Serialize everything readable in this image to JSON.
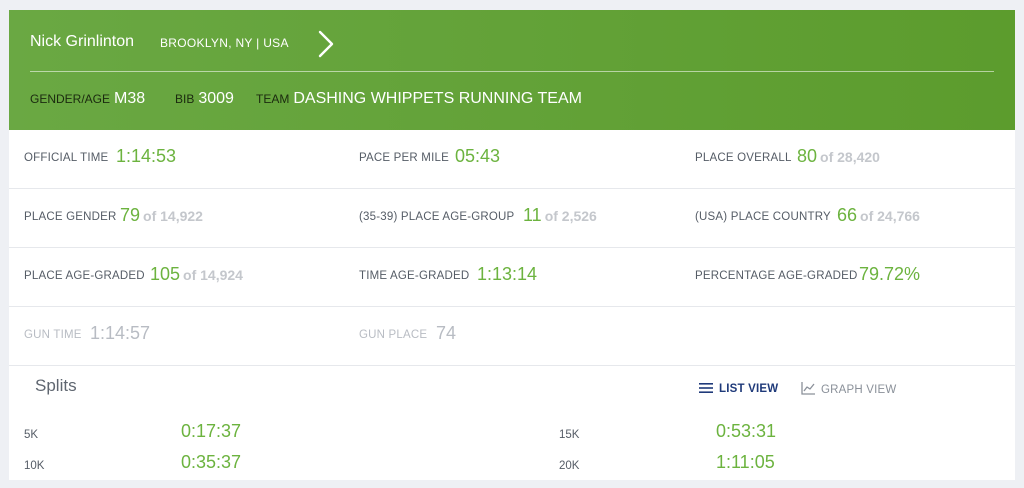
{
  "runner": {
    "name": "Nick Grinlinton",
    "location": "BROOKLYN, NY | USA",
    "gender_age_label": "GENDER/AGE",
    "gender_age": "M38",
    "bib_label": "BIB",
    "bib": "3009",
    "team_label": "TEAM",
    "team": "DASHING WHIPPETS RUNNING TEAM"
  },
  "stats": {
    "official_time": {
      "label": "OFFICIAL TIME",
      "value": "1:14:53"
    },
    "pace_per_mile": {
      "label": "PACE PER MILE",
      "value": "05:43"
    },
    "place_overall": {
      "label": "PLACE OVERALL",
      "value": "80",
      "of": "of 28,420"
    },
    "place_gender": {
      "label": "PLACE GENDER",
      "value": "79",
      "of": "of 14,922"
    },
    "place_age_group": {
      "label": "(35-39) PLACE AGE-GROUP",
      "value": "11",
      "of": "of 2,526"
    },
    "place_country": {
      "label": "(USA) PLACE COUNTRY",
      "value": "66",
      "of": "of 24,766"
    },
    "place_age_graded": {
      "label": "PLACE AGE-GRADED",
      "value": "105",
      "of": "of 14,924"
    },
    "time_age_graded": {
      "label": "TIME AGE-GRADED",
      "value": "1:13:14"
    },
    "percentage_age_graded": {
      "label": "PERCENTAGE AGE-GRADED",
      "value": "79.72%"
    },
    "gun_time": {
      "label": "GUN TIME",
      "value": "1:14:57"
    },
    "gun_place": {
      "label": "GUN PLACE",
      "value": "74"
    }
  },
  "splits": {
    "title": "Splits",
    "list_view_label": "LIST VIEW",
    "graph_view_label": "GRAPH VIEW",
    "items": [
      {
        "label": "5K",
        "value": "0:17:37"
      },
      {
        "label": "15K",
        "value": "0:53:31"
      },
      {
        "label": "10K",
        "value": "0:35:37"
      },
      {
        "label": "20K",
        "value": "1:11:05"
      }
    ]
  },
  "colors": {
    "header_green": "#5c9c2d",
    "value_green": "#6cb33f",
    "muted_gray": "#c4c7cc",
    "active_navy": "#1f3a7a"
  },
  "icons": {
    "next": "chevron-right-icon",
    "list_view": "list-icon",
    "graph_view": "line-chart-icon"
  }
}
